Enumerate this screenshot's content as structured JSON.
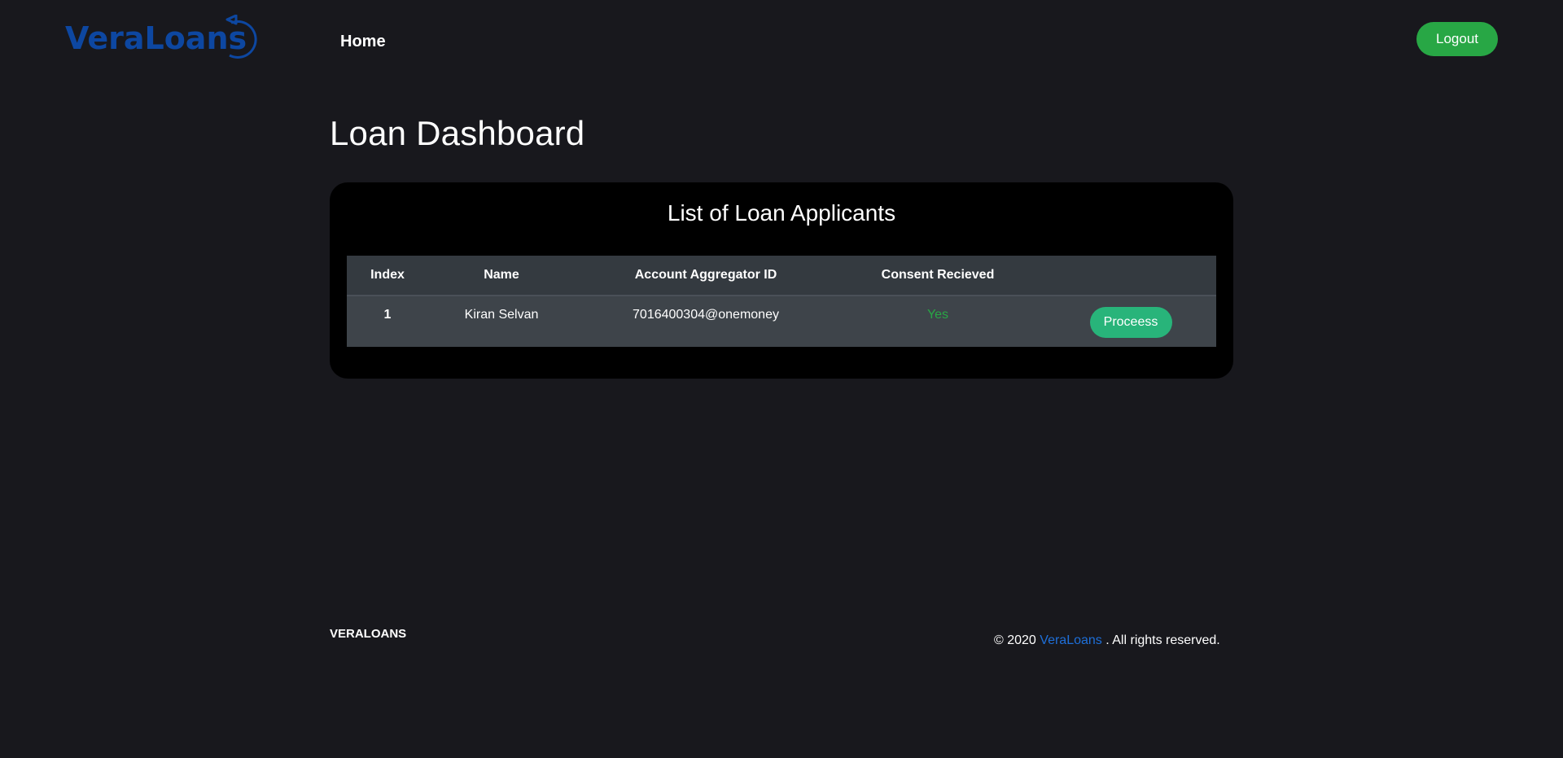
{
  "brand": {
    "logo_text": "VeraLoans",
    "logo_color": "#0d47a1"
  },
  "nav": {
    "home_label": "Home",
    "logout_label": "Logout"
  },
  "page": {
    "title": "Loan Dashboard"
  },
  "applicants": {
    "title": "List of Loan Applicants",
    "columns": [
      "Index",
      "Name",
      "Account Aggregator ID",
      "Consent Recieved",
      ""
    ],
    "rows": [
      {
        "index": "1",
        "name": "Kiran Selvan",
        "aa_id": "7016400304@onemoney",
        "consent": "Yes",
        "action_label": "Proceess"
      }
    ]
  },
  "footer": {
    "brand": "VERALOANS",
    "copy_prefix": "© 2020",
    "copy_link": "VeraLoans",
    "copy_suffix": ". All rights reserved."
  },
  "colors": {
    "background": "#18181d",
    "card": "#000000",
    "table_header": "#343a40",
    "table_row": "#3e444a",
    "accent_green": "#28a745",
    "process_green": "#28b47a",
    "link_blue": "#1e6fd9"
  }
}
